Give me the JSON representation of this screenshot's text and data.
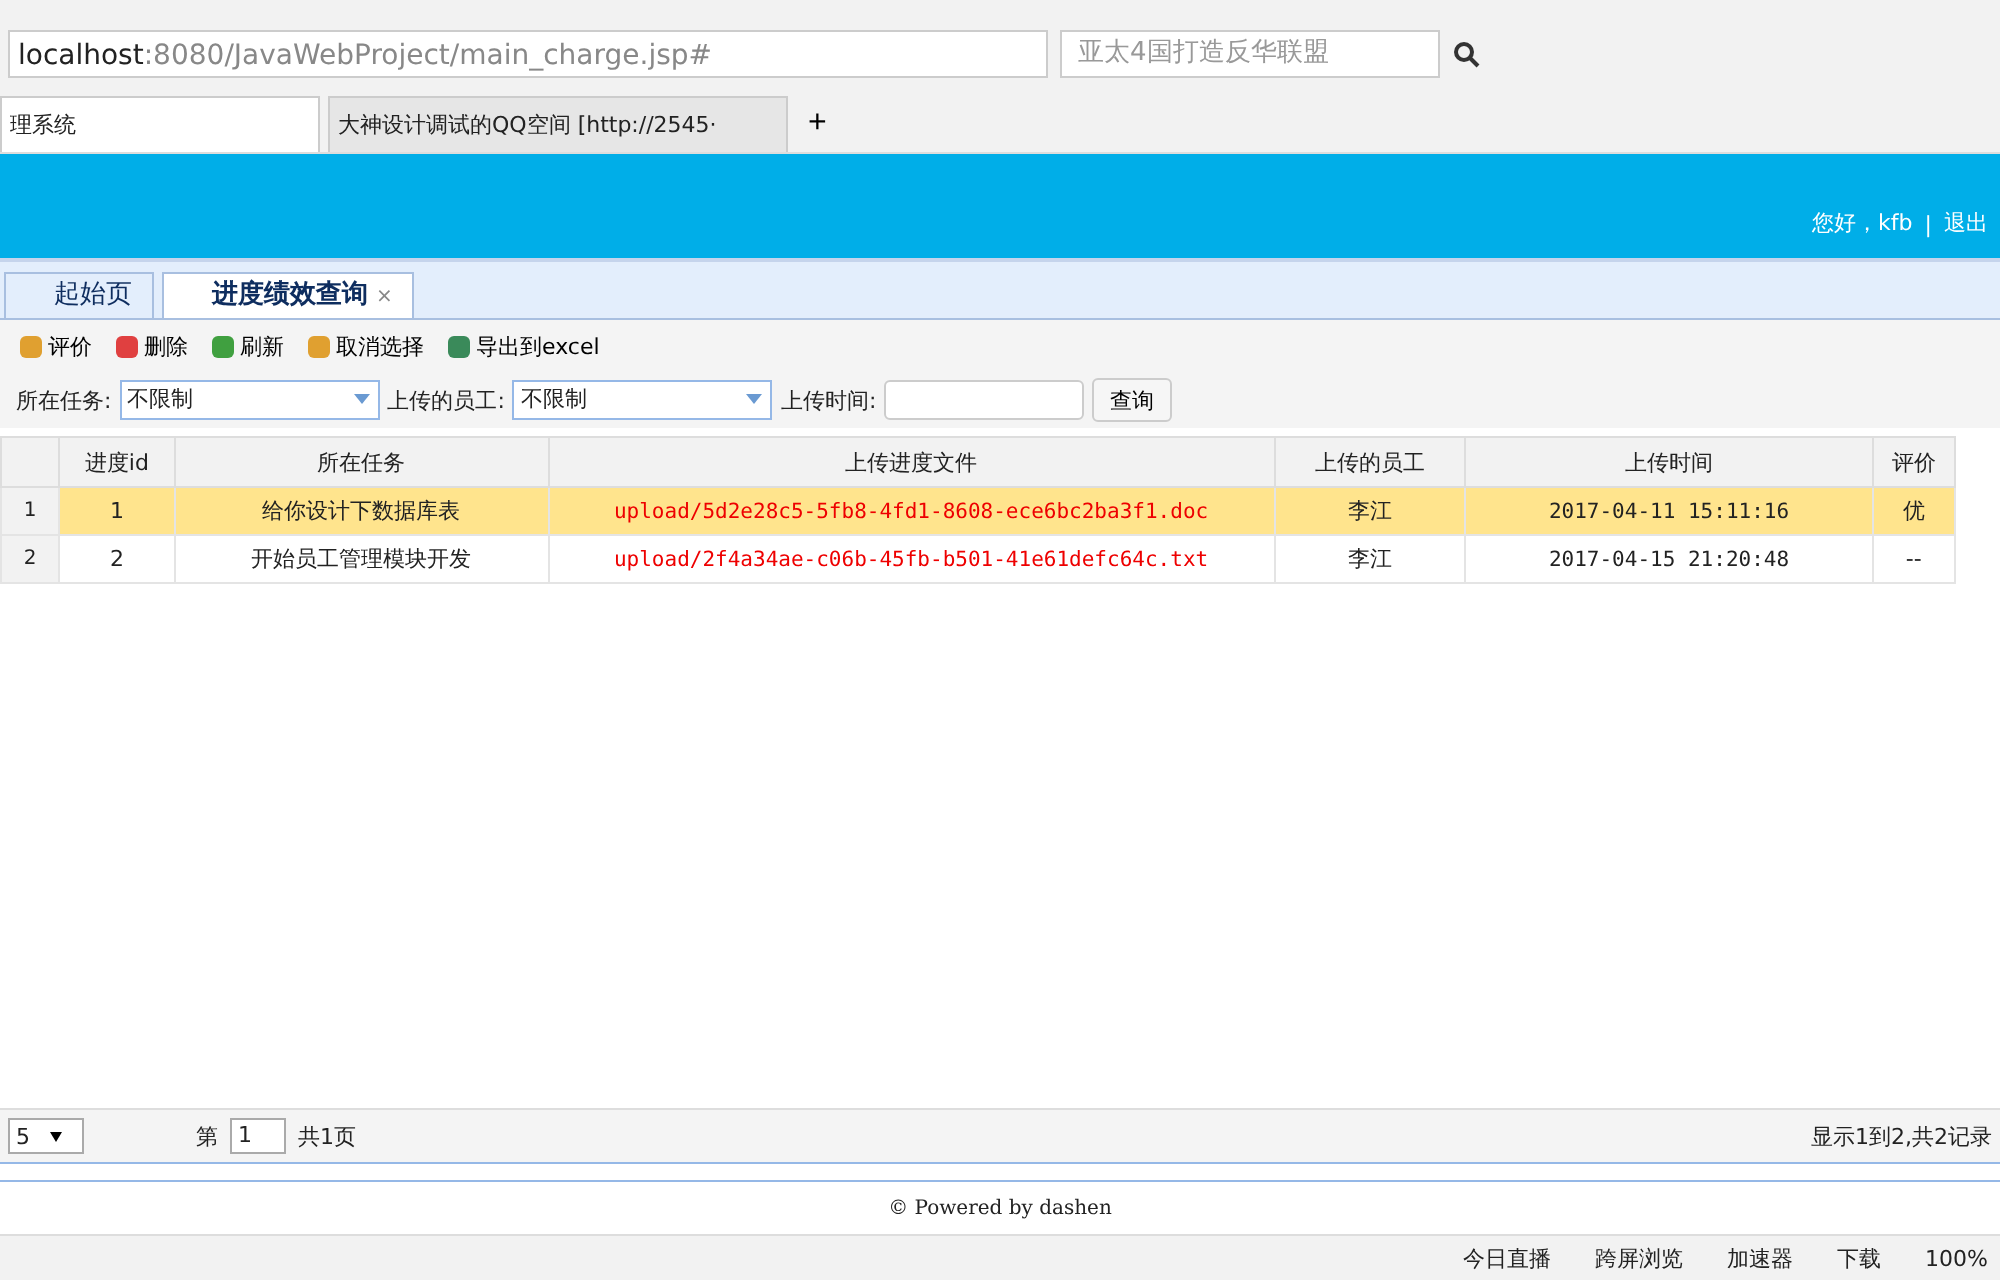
{
  "browser": {
    "address_host": "localhost",
    "address_rest": ":8080/JavaWebProject/main_charge.jsp#",
    "search_placeholder": "亚太4国打造反华联盟",
    "tabs": [
      {
        "label": "理系统",
        "selected": true
      },
      {
        "label": "大神设计调试的QQ空间 [http://2545·",
        "selected": false
      }
    ],
    "new_tab": "+"
  },
  "header": {
    "greeting": "您好，kfb",
    "separator": "|",
    "logout": "退出"
  },
  "page_tabs": [
    {
      "label": "起始页",
      "selected": false,
      "closable": false
    },
    {
      "label": "进度绩效查询",
      "selected": true,
      "closable": true,
      "close": "×"
    }
  ],
  "toolbar": [
    {
      "label": "评价",
      "kind": "pencil"
    },
    {
      "label": "删除",
      "kind": "delete"
    },
    {
      "label": "刷新",
      "kind": "refresh"
    },
    {
      "label": "取消选择",
      "kind": "undo"
    },
    {
      "label": "导出到excel",
      "kind": "export"
    }
  ],
  "filters": {
    "task_label": "所在任务:",
    "task_value": "不限制",
    "employee_label": "上传的员工:",
    "employee_value": "不限制",
    "time_label": "上传时间:",
    "query_button": "查询"
  },
  "table": {
    "columns": [
      "进度id",
      "所在任务",
      "上传进度文件",
      "上传的员工",
      "上传时间",
      "评价"
    ],
    "rows": [
      {
        "num": "1",
        "id": "1",
        "task": "给你设计下数据库表",
        "file": "upload/5d2e28c5-5fb8-4fd1-8608-ece6bc2ba3f1.doc",
        "employee": "李江",
        "time": "2017-04-11 15:11:16",
        "rating": "优",
        "selected": true
      },
      {
        "num": "2",
        "id": "2",
        "task": "开始员工管理模块开发",
        "file": "upload/2f4a34ae-c06b-45fb-b501-41e61defc64c.txt",
        "employee": "李江",
        "time": "2017-04-15 21:20:48",
        "rating": "--",
        "selected": false
      }
    ]
  },
  "pager": {
    "page_size": "5",
    "page_prefix": "第",
    "page": "1",
    "page_suffix": "共1页",
    "summary": "显示1到2,共2记录"
  },
  "footer": "© Powered by dashen",
  "status_bar": [
    "今日直播",
    "跨屏浏览",
    "加速器",
    "下载",
    "100%"
  ]
}
